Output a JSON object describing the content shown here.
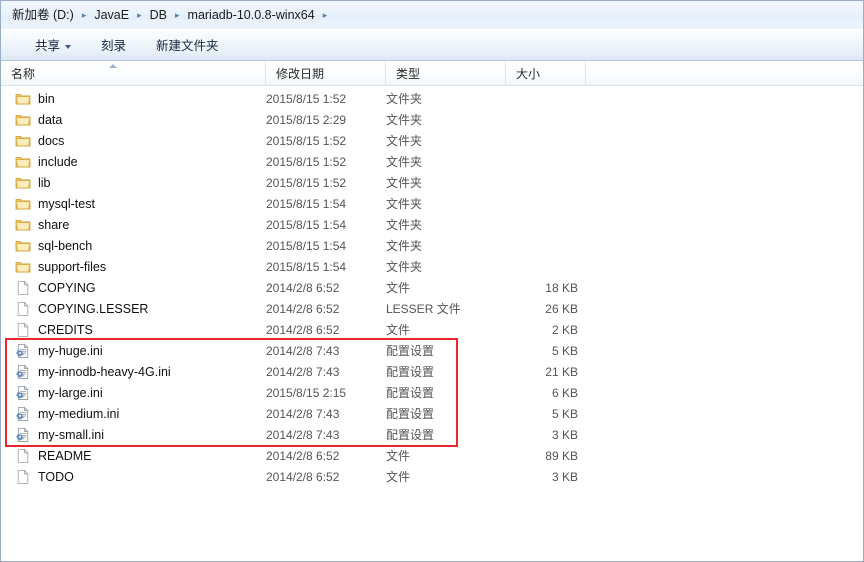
{
  "window": {
    "title": "mariadb-10.0.8-winx64"
  },
  "address_bar": {
    "name": "breadcrumb",
    "crumbs": [
      {
        "label": "新加卷 (D:)"
      },
      {
        "label": "JavaE"
      },
      {
        "label": "DB"
      },
      {
        "label": "mariadb-10.0.8-winx64"
      }
    ],
    "separator": "▸"
  },
  "toolbar": {
    "share_label": "共享",
    "burn_label": "刻录",
    "new_folder_label": "新建文件夹"
  },
  "columns": {
    "name": "名称",
    "date_modified": "修改日期",
    "type": "类型",
    "size": "大小",
    "sort_column": "名称",
    "sort_direction": "ascending"
  },
  "annotation": {
    "color": "#e8262b",
    "highlights_rows": [
      "my-huge.ini",
      "my-innodb-heavy-4G.ini",
      "my-large.ini",
      "my-medium.ini",
      "my-small.ini"
    ]
  },
  "types": {
    "folder": "文件夹",
    "file": "文件",
    "lesser_file": "LESSER 文件",
    "config": "配置设置"
  },
  "rows": [
    {
      "name": "bin",
      "date": "2015/8/15 1:52",
      "type": "文件夹",
      "size": "",
      "icon": "folder-icon",
      "highlighted": false
    },
    {
      "name": "data",
      "date": "2015/8/15 2:29",
      "type": "文件夹",
      "size": "",
      "icon": "folder-icon",
      "highlighted": false
    },
    {
      "name": "docs",
      "date": "2015/8/15 1:52",
      "type": "文件夹",
      "size": "",
      "icon": "folder-icon",
      "highlighted": false
    },
    {
      "name": "include",
      "date": "2015/8/15 1:52",
      "type": "文件夹",
      "size": "",
      "icon": "folder-icon",
      "highlighted": false
    },
    {
      "name": "lib",
      "date": "2015/8/15 1:52",
      "type": "文件夹",
      "size": "",
      "icon": "folder-icon",
      "highlighted": false
    },
    {
      "name": "mysql-test",
      "date": "2015/8/15 1:54",
      "type": "文件夹",
      "size": "",
      "icon": "folder-icon",
      "highlighted": false
    },
    {
      "name": "share",
      "date": "2015/8/15 1:54",
      "type": "文件夹",
      "size": "",
      "icon": "folder-icon",
      "highlighted": false
    },
    {
      "name": "sql-bench",
      "date": "2015/8/15 1:54",
      "type": "文件夹",
      "size": "",
      "icon": "folder-icon",
      "highlighted": false
    },
    {
      "name": "support-files",
      "date": "2015/8/15 1:54",
      "type": "文件夹",
      "size": "",
      "icon": "folder-icon",
      "highlighted": false
    },
    {
      "name": "COPYING",
      "date": "2014/2/8 6:52",
      "type": "文件",
      "size": "18 KB",
      "icon": "file-icon",
      "highlighted": false
    },
    {
      "name": "COPYING.LESSER",
      "date": "2014/2/8 6:52",
      "type": "LESSER 文件",
      "size": "26 KB",
      "icon": "file-icon",
      "highlighted": false
    },
    {
      "name": "CREDITS",
      "date": "2014/2/8 6:52",
      "type": "文件",
      "size": "2 KB",
      "icon": "file-icon",
      "highlighted": false
    },
    {
      "name": "my-huge.ini",
      "date": "2014/2/8 7:43",
      "type": "配置设置",
      "size": "5 KB",
      "icon": "ini-config-icon",
      "highlighted": true
    },
    {
      "name": "my-innodb-heavy-4G.ini",
      "date": "2014/2/8 7:43",
      "type": "配置设置",
      "size": "21 KB",
      "icon": "ini-config-icon",
      "highlighted": true
    },
    {
      "name": "my-large.ini",
      "date": "2015/8/15 2:15",
      "type": "配置设置",
      "size": "6 KB",
      "icon": "ini-config-icon",
      "highlighted": true
    },
    {
      "name": "my-medium.ini",
      "date": "2014/2/8 7:43",
      "type": "配置设置",
      "size": "5 KB",
      "icon": "ini-config-icon",
      "highlighted": true
    },
    {
      "name": "my-small.ini",
      "date": "2014/2/8 7:43",
      "type": "配置设置",
      "size": "3 KB",
      "icon": "ini-config-icon",
      "highlighted": true
    },
    {
      "name": "README",
      "date": "2014/2/8 6:52",
      "type": "文件",
      "size": "89 KB",
      "icon": "file-icon",
      "highlighted": false
    },
    {
      "name": "TODO",
      "date": "2014/2/8 6:52",
      "type": "文件",
      "size": "3 KB",
      "icon": "file-icon",
      "highlighted": false
    }
  ]
}
